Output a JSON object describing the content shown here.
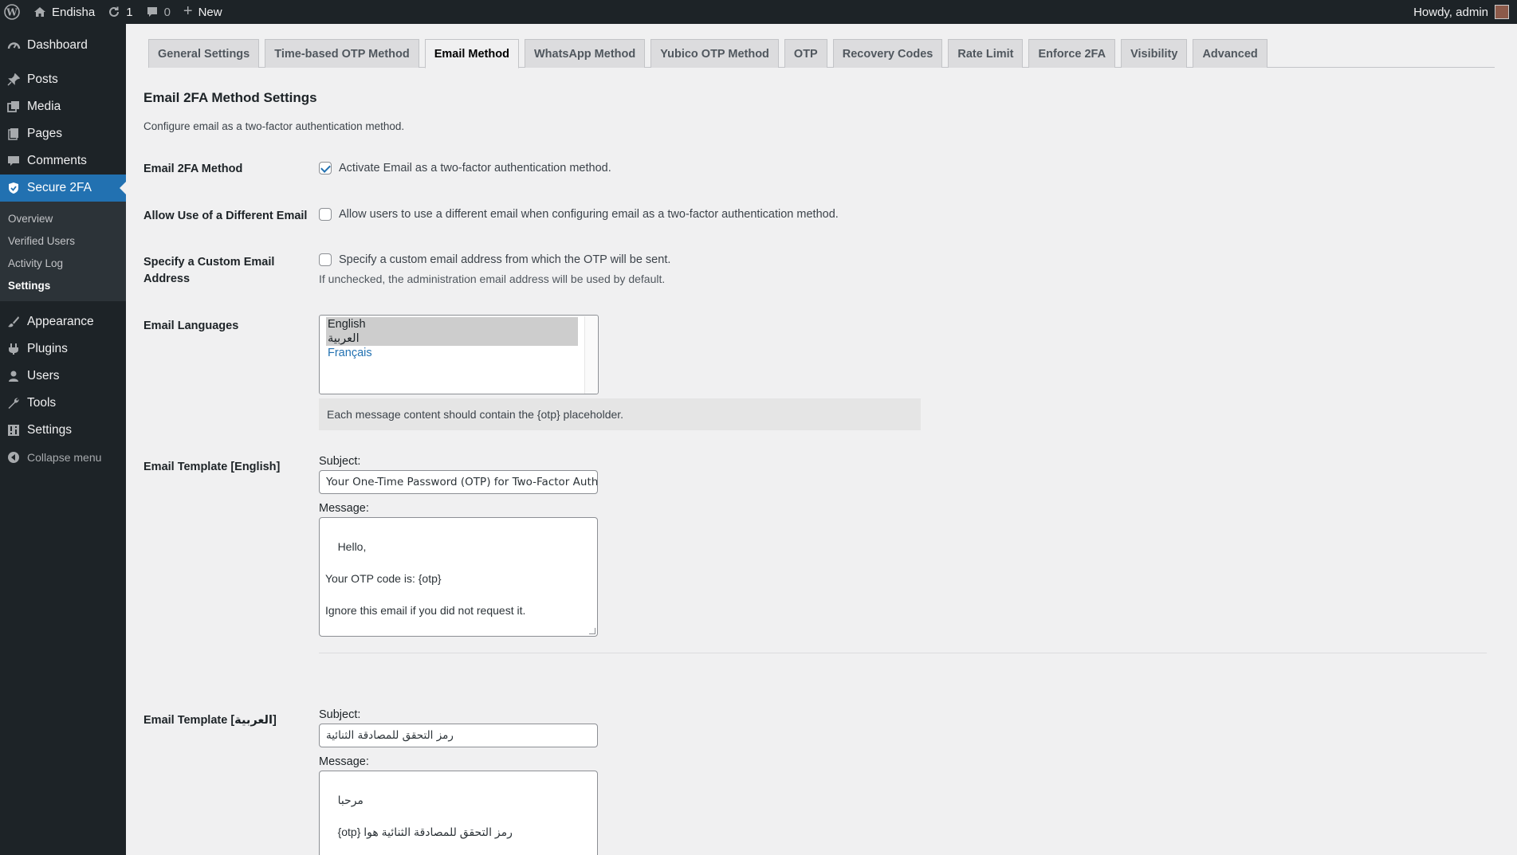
{
  "adminbar": {
    "site_name": "Endisha",
    "updates_count": "1",
    "comments_count": "0",
    "new_label": "New",
    "howdy": "Howdy, admin"
  },
  "sidebar": {
    "items": [
      {
        "label": "Dashboard",
        "icon": "dashboard-icon"
      },
      {
        "label": "Posts",
        "icon": "pin-icon"
      },
      {
        "label": "Media",
        "icon": "media-icon"
      },
      {
        "label": "Pages",
        "icon": "pages-icon"
      },
      {
        "label": "Comments",
        "icon": "comment-icon"
      },
      {
        "label": "Secure 2FA",
        "icon": "shield-icon"
      }
    ],
    "submenu": [
      "Overview",
      "Verified Users",
      "Activity Log",
      "Settings"
    ],
    "items2": [
      {
        "label": "Appearance",
        "icon": "brush-icon"
      },
      {
        "label": "Plugins",
        "icon": "plugin-icon"
      },
      {
        "label": "Users",
        "icon": "users-icon"
      },
      {
        "label": "Tools",
        "icon": "wrench-icon"
      },
      {
        "label": "Settings",
        "icon": "settings-icon"
      }
    ],
    "collapse": "Collapse menu"
  },
  "tabs": [
    "General Settings",
    "Time-based OTP Method",
    "Email Method",
    "WhatsApp Method",
    "Yubico OTP Method",
    "OTP",
    "Recovery Codes",
    "Rate Limit",
    "Enforce 2FA",
    "Visibility",
    "Advanced"
  ],
  "active_tab": "Email Method",
  "page": {
    "title": "Email 2FA Method Settings",
    "description": "Configure email as a two-factor authentication method."
  },
  "rows": {
    "email_method": {
      "label": "Email 2FA Method",
      "checkbox": "Activate Email as a two-factor authentication method.",
      "checked": true
    },
    "different_email": {
      "label": "Allow Use of a Different Email",
      "checkbox": "Allow users to use a different email when configuring email as a two-factor authentication method.",
      "checked": false
    },
    "custom_email": {
      "label": "Specify a Custom Email Address",
      "checkbox": "Specify a custom email address from which the OTP will be sent.",
      "hint": "If unchecked, the administration email address will be used by default.",
      "checked": false
    },
    "languages": {
      "label": "Email Languages",
      "options": [
        "English",
        "العربية",
        "Français"
      ],
      "notice": "Each message content should contain the {otp} placeholder."
    }
  },
  "templates": {
    "en": {
      "label": "Email Template [English]",
      "subject_label": "Subject:",
      "subject": "Your One-Time Password (OTP) for Two-Factor Authentication",
      "message_label": "Message:",
      "message": "Hello,\n\nYour OTP code is: {otp}\n\nIgnore this email if you did not request it.\n\nThank you!"
    },
    "ar": {
      "label": "Email Template [العربية]",
      "subject_label": "Subject:",
      "subject": "رمز التحقق للمصادقة الثنائية",
      "message_label": "Message:",
      "message": "مرحبا\n\nرمز التحقق للمصادقة الثنائية هوا {otp}\n\nشكرا لك"
    }
  }
}
